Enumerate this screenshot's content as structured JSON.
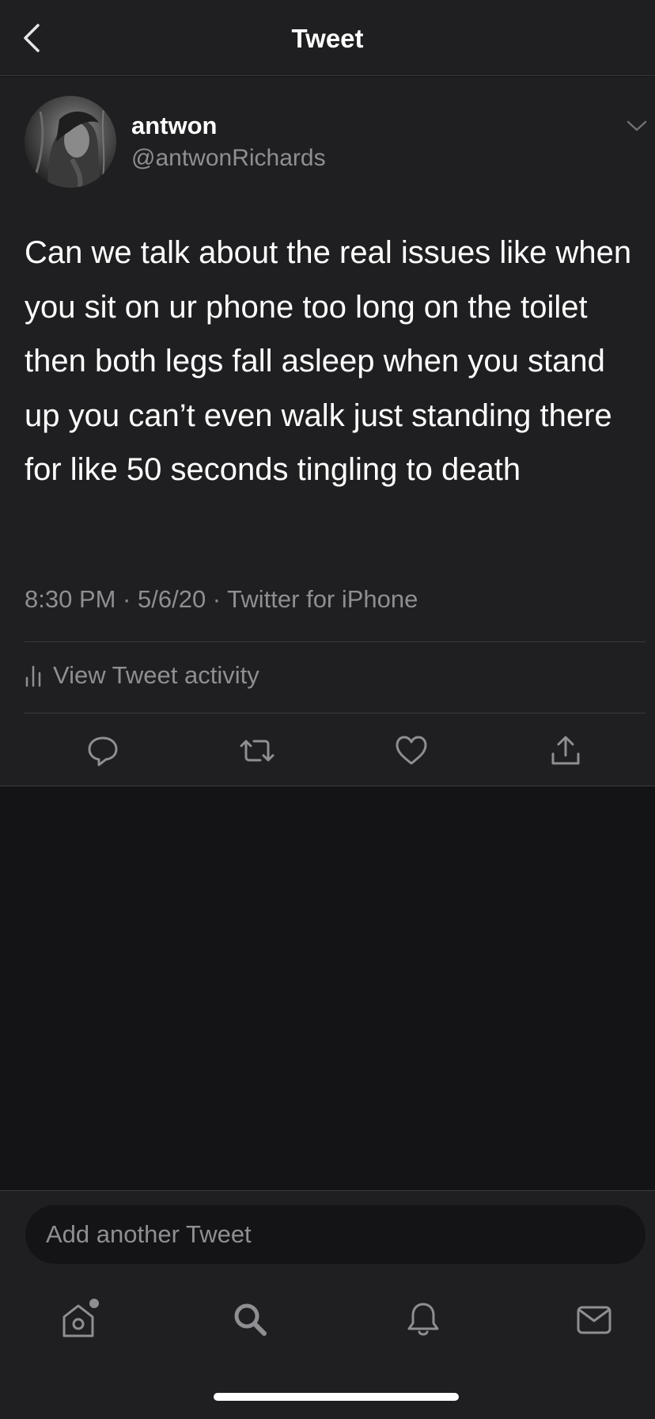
{
  "header": {
    "title": "Tweet",
    "back_icon": "chevron-left-icon"
  },
  "tweet": {
    "author_name": "antwon",
    "author_handle": "@antwonRichards",
    "text": "Can we talk about the real issues like when you sit on ur phone too long on the toilet then both legs fall asleep when you stand up you can’t even walk just standing there for like 50 seconds tingling to death",
    "meta": "8:30 PM · 5/6/20 · Twitter for iPhone",
    "activity_label": "View Tweet activity",
    "actions": [
      "reply-icon",
      "retweet-icon",
      "like-icon",
      "share-icon"
    ]
  },
  "composer": {
    "placeholder": "Add another Tweet"
  },
  "tabbar": {
    "items": [
      "home-icon",
      "search-icon",
      "notifications-icon",
      "messages-icon"
    ],
    "home_has_dot": true
  },
  "colors": {
    "background": "#141416",
    "surface": "#1f1f21",
    "divider": "#3a3a3c",
    "text_primary": "#ffffff",
    "text_secondary": "#8e8e93"
  }
}
